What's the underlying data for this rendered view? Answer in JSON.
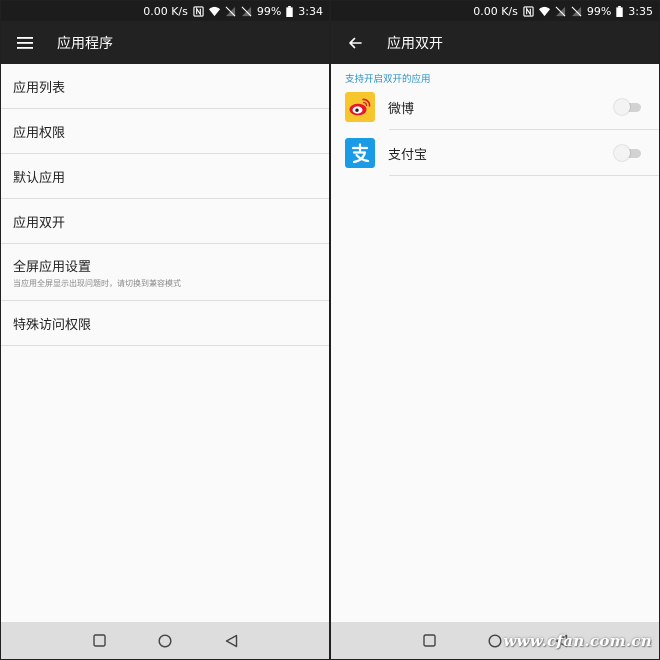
{
  "left": {
    "status": {
      "speed": "0.00 K/s",
      "battery": "99%",
      "time": "3:34"
    },
    "toolbar": {
      "title": "应用程序"
    },
    "items": [
      {
        "label": "应用列表"
      },
      {
        "label": "应用权限"
      },
      {
        "label": "默认应用"
      },
      {
        "label": "应用双开"
      },
      {
        "label": "全屏应用设置",
        "sub": "当应用全屏显示出现问题时，请切换到兼容模式"
      },
      {
        "label": "特殊访问权限"
      }
    ]
  },
  "right": {
    "status": {
      "speed": "0.00 K/s",
      "battery": "99%",
      "time": "3:35"
    },
    "toolbar": {
      "title": "应用双开"
    },
    "section_header": "支持开启双开的应用",
    "apps": [
      {
        "name": "微博",
        "icon": "weibo-icon",
        "enabled": false
      },
      {
        "name": "支付宝",
        "icon": "alipay-icon",
        "enabled": false
      }
    ]
  },
  "watermark": "www.cfan.com.cn",
  "colors": {
    "accent": "#2a92c6",
    "toolbar": "#222222",
    "background": "#fafafa",
    "navbar": "#dddddd"
  }
}
